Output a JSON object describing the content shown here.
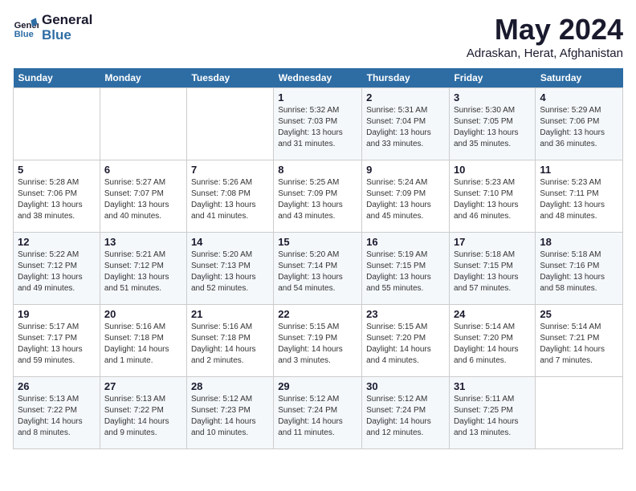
{
  "logo": {
    "line1": "General",
    "line2": "Blue"
  },
  "title": "May 2024",
  "location": "Adraskan, Herat, Afghanistan",
  "days_of_week": [
    "Sunday",
    "Monday",
    "Tuesday",
    "Wednesday",
    "Thursday",
    "Friday",
    "Saturday"
  ],
  "weeks": [
    [
      {
        "day": "",
        "info": ""
      },
      {
        "day": "",
        "info": ""
      },
      {
        "day": "",
        "info": ""
      },
      {
        "day": "1",
        "info": "Sunrise: 5:32 AM\nSunset: 7:03 PM\nDaylight: 13 hours\nand 31 minutes."
      },
      {
        "day": "2",
        "info": "Sunrise: 5:31 AM\nSunset: 7:04 PM\nDaylight: 13 hours\nand 33 minutes."
      },
      {
        "day": "3",
        "info": "Sunrise: 5:30 AM\nSunset: 7:05 PM\nDaylight: 13 hours\nand 35 minutes."
      },
      {
        "day": "4",
        "info": "Sunrise: 5:29 AM\nSunset: 7:06 PM\nDaylight: 13 hours\nand 36 minutes."
      }
    ],
    [
      {
        "day": "5",
        "info": "Sunrise: 5:28 AM\nSunset: 7:06 PM\nDaylight: 13 hours\nand 38 minutes."
      },
      {
        "day": "6",
        "info": "Sunrise: 5:27 AM\nSunset: 7:07 PM\nDaylight: 13 hours\nand 40 minutes."
      },
      {
        "day": "7",
        "info": "Sunrise: 5:26 AM\nSunset: 7:08 PM\nDaylight: 13 hours\nand 41 minutes."
      },
      {
        "day": "8",
        "info": "Sunrise: 5:25 AM\nSunset: 7:09 PM\nDaylight: 13 hours\nand 43 minutes."
      },
      {
        "day": "9",
        "info": "Sunrise: 5:24 AM\nSunset: 7:09 PM\nDaylight: 13 hours\nand 45 minutes."
      },
      {
        "day": "10",
        "info": "Sunrise: 5:23 AM\nSunset: 7:10 PM\nDaylight: 13 hours\nand 46 minutes."
      },
      {
        "day": "11",
        "info": "Sunrise: 5:23 AM\nSunset: 7:11 PM\nDaylight: 13 hours\nand 48 minutes."
      }
    ],
    [
      {
        "day": "12",
        "info": "Sunrise: 5:22 AM\nSunset: 7:12 PM\nDaylight: 13 hours\nand 49 minutes."
      },
      {
        "day": "13",
        "info": "Sunrise: 5:21 AM\nSunset: 7:12 PM\nDaylight: 13 hours\nand 51 minutes."
      },
      {
        "day": "14",
        "info": "Sunrise: 5:20 AM\nSunset: 7:13 PM\nDaylight: 13 hours\nand 52 minutes."
      },
      {
        "day": "15",
        "info": "Sunrise: 5:20 AM\nSunset: 7:14 PM\nDaylight: 13 hours\nand 54 minutes."
      },
      {
        "day": "16",
        "info": "Sunrise: 5:19 AM\nSunset: 7:15 PM\nDaylight: 13 hours\nand 55 minutes."
      },
      {
        "day": "17",
        "info": "Sunrise: 5:18 AM\nSunset: 7:15 PM\nDaylight: 13 hours\nand 57 minutes."
      },
      {
        "day": "18",
        "info": "Sunrise: 5:18 AM\nSunset: 7:16 PM\nDaylight: 13 hours\nand 58 minutes."
      }
    ],
    [
      {
        "day": "19",
        "info": "Sunrise: 5:17 AM\nSunset: 7:17 PM\nDaylight: 13 hours\nand 59 minutes."
      },
      {
        "day": "20",
        "info": "Sunrise: 5:16 AM\nSunset: 7:18 PM\nDaylight: 14 hours\nand 1 minute."
      },
      {
        "day": "21",
        "info": "Sunrise: 5:16 AM\nSunset: 7:18 PM\nDaylight: 14 hours\nand 2 minutes."
      },
      {
        "day": "22",
        "info": "Sunrise: 5:15 AM\nSunset: 7:19 PM\nDaylight: 14 hours\nand 3 minutes."
      },
      {
        "day": "23",
        "info": "Sunrise: 5:15 AM\nSunset: 7:20 PM\nDaylight: 14 hours\nand 4 minutes."
      },
      {
        "day": "24",
        "info": "Sunrise: 5:14 AM\nSunset: 7:20 PM\nDaylight: 14 hours\nand 6 minutes."
      },
      {
        "day": "25",
        "info": "Sunrise: 5:14 AM\nSunset: 7:21 PM\nDaylight: 14 hours\nand 7 minutes."
      }
    ],
    [
      {
        "day": "26",
        "info": "Sunrise: 5:13 AM\nSunset: 7:22 PM\nDaylight: 14 hours\nand 8 minutes."
      },
      {
        "day": "27",
        "info": "Sunrise: 5:13 AM\nSunset: 7:22 PM\nDaylight: 14 hours\nand 9 minutes."
      },
      {
        "day": "28",
        "info": "Sunrise: 5:12 AM\nSunset: 7:23 PM\nDaylight: 14 hours\nand 10 minutes."
      },
      {
        "day": "29",
        "info": "Sunrise: 5:12 AM\nSunset: 7:24 PM\nDaylight: 14 hours\nand 11 minutes."
      },
      {
        "day": "30",
        "info": "Sunrise: 5:12 AM\nSunset: 7:24 PM\nDaylight: 14 hours\nand 12 minutes."
      },
      {
        "day": "31",
        "info": "Sunrise: 5:11 AM\nSunset: 7:25 PM\nDaylight: 14 hours\nand 13 minutes."
      },
      {
        "day": "",
        "info": ""
      }
    ]
  ]
}
